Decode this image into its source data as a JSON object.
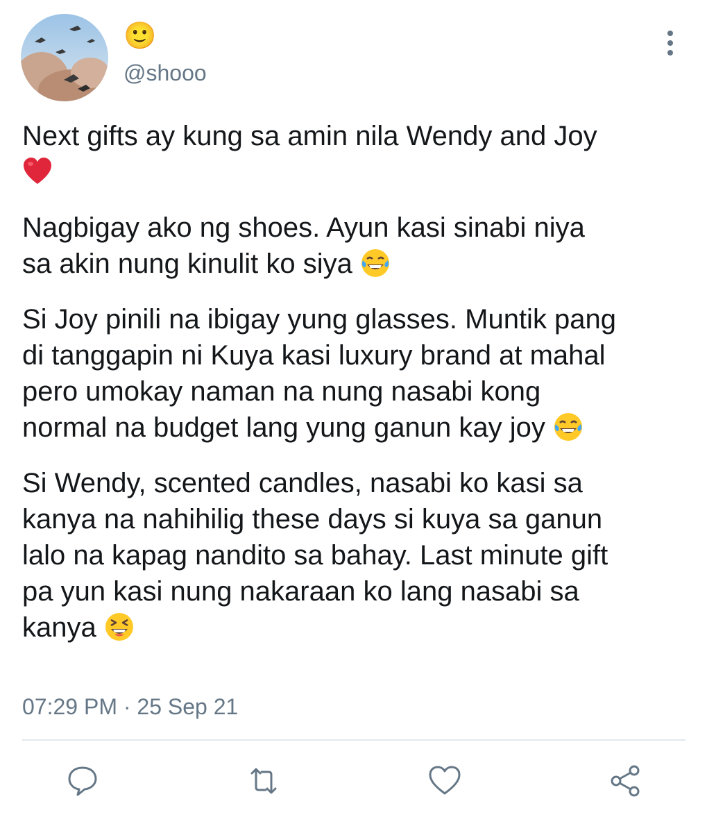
{
  "tweet": {
    "display_name": "🙂",
    "handle": "@shooo",
    "paragraphs": [
      {
        "text": "Next gifts ay kung sa amin nila Wendy and Joy\n",
        "emoji": "red-heart"
      },
      {
        "text": "Nagbigay ako ng shoes. Ayun kasi sinabi niya\nsa akin nung kinulit ko siya ",
        "emoji": "tears-of-joy"
      },
      {
        "text": "Si Joy pinili na ibigay yung glasses. Muntik pang\ndi tanggapin ni Kuya kasi luxury brand at mahal\npero umokay naman na nung nasabi kong\nnormal na budget lang yung ganun kay joy ",
        "emoji": "tears-of-joy"
      },
      {
        "text": "Si Wendy, scented candles, nasabi ko kasi sa\nkanya na nahihilig these days si kuya sa ganun\nlalo na kapag nandito sa bahay. Last minute gift\npa yun kasi nung nakaraan ko lang nasabi sa\nkanya ",
        "emoji": "grinning-squinting"
      }
    ],
    "timestamp": "07:29 PM · 25 Sep 21"
  },
  "actions": [
    {
      "name": "reply-button",
      "icon": "reply-icon"
    },
    {
      "name": "retweet-button",
      "icon": "retweet-icon"
    },
    {
      "name": "like-button",
      "icon": "heart-icon"
    },
    {
      "name": "share-button",
      "icon": "share-icon"
    }
  ],
  "colors": {
    "text": "#14171a",
    "secondary": "#657786",
    "divider": "#e1e8ed",
    "icon": "#657786"
  }
}
